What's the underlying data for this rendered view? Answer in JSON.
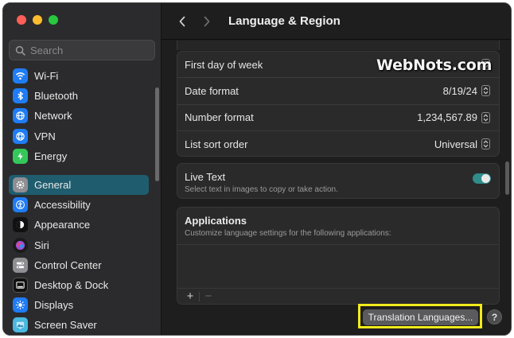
{
  "window": {
    "title": "Language & Region"
  },
  "sidebar": {
    "search_placeholder": "Search",
    "network_items": [
      {
        "label": "Wi-Fi",
        "icon": "wifi-icon",
        "color": "#1f7cf5"
      },
      {
        "label": "Bluetooth",
        "icon": "bluetooth-icon",
        "color": "#1f7cf5"
      },
      {
        "label": "Network",
        "icon": "globe-icon",
        "color": "#1f7cf5"
      },
      {
        "label": "VPN",
        "icon": "vpn-globe-icon",
        "color": "#1f7cf5"
      },
      {
        "label": "Energy",
        "icon": "bolt-icon",
        "color": "#34c759"
      }
    ],
    "system_items": [
      {
        "label": "General",
        "icon": "gear-icon",
        "color": "#8e8e93",
        "selected": true
      },
      {
        "label": "Accessibility",
        "icon": "accessibility-icon",
        "color": "#1f7cf5"
      },
      {
        "label": "Appearance",
        "icon": "appearance-icon",
        "color": "#111111"
      },
      {
        "label": "Siri",
        "icon": "siri-icon",
        "color": "#a14fd0"
      },
      {
        "label": "Control Center",
        "icon": "control-center-icon",
        "color": "#8e8e93"
      },
      {
        "label": "Desktop & Dock",
        "icon": "dock-icon",
        "color": "#111111"
      },
      {
        "label": "Displays",
        "icon": "sun-icon",
        "color": "#1f7cf5"
      },
      {
        "label": "Screen Saver",
        "icon": "screen-saver-icon",
        "color": "#4ab8e0"
      }
    ]
  },
  "format_rows": [
    {
      "label": "First day of week",
      "value": ""
    },
    {
      "label": "Date format",
      "value": "8/19/24"
    },
    {
      "label": "Number format",
      "value": "1,234,567.89"
    },
    {
      "label": "List sort order",
      "value": "Universal"
    }
  ],
  "live_text": {
    "title": "Live Text",
    "subtitle": "Select text in images to copy or take action.",
    "enabled": true
  },
  "applications": {
    "title": "Applications",
    "subtitle": "Customize language settings for the following applications:",
    "add_label": "+",
    "remove_label": "−"
  },
  "footer": {
    "translation_button": "Translation Languages...",
    "help_label": "?"
  },
  "watermark": "WebNots.com",
  "colors": {
    "accent": "#1f5d6e",
    "highlight": "#f2ea1a",
    "toggle_on": "#2f8c8a"
  }
}
